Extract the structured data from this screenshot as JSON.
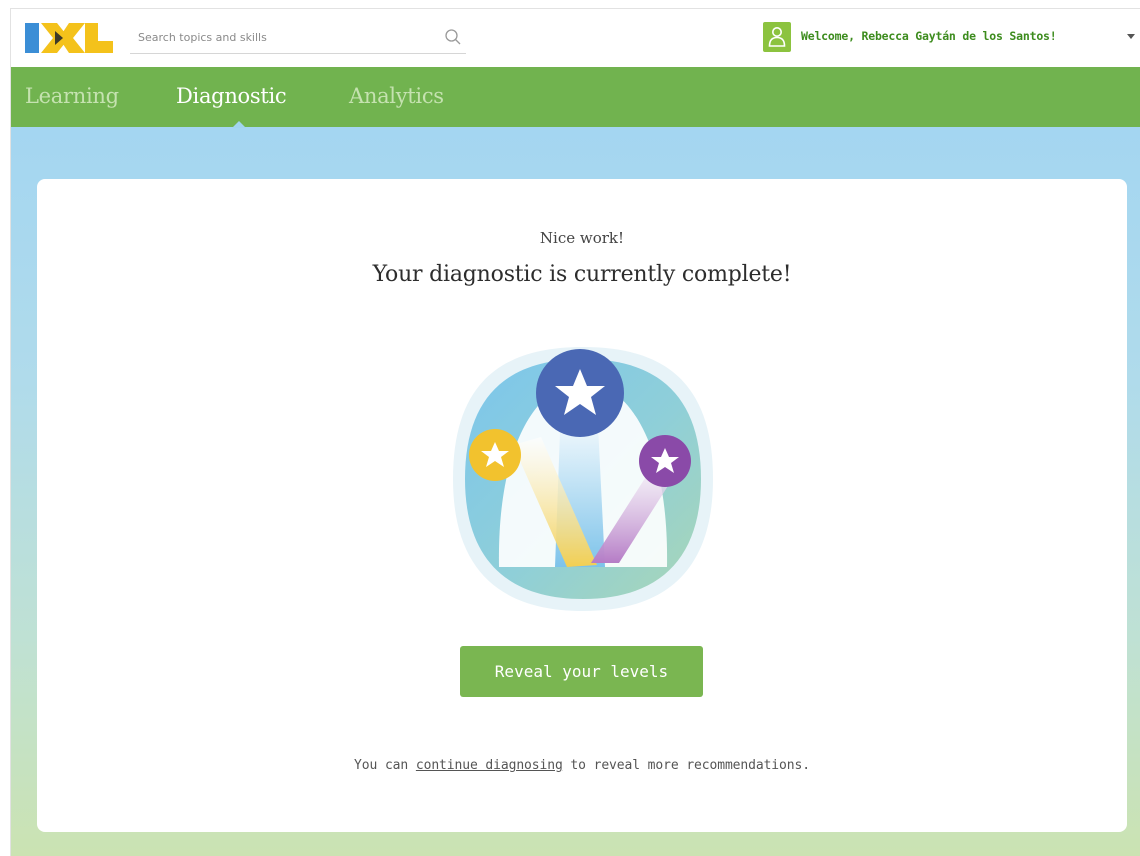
{
  "header": {
    "logo_text": "IXL",
    "search": {
      "placeholder": "Search topics and skills",
      "value": ""
    },
    "search_icon": "search-icon",
    "user_icon": "user-icon",
    "welcome_text": "Welcome, Rebecca Gaytán de los Santos!",
    "dropdown_icon": "caret-down-icon"
  },
  "nav": {
    "tabs": [
      {
        "label": "Learning",
        "active": false
      },
      {
        "label": "Diagnostic",
        "active": true
      },
      {
        "label": "Analytics",
        "active": false
      }
    ]
  },
  "card": {
    "subtitle": "Nice work!",
    "title": "Your diagnostic is currently complete!",
    "badge_icon": "shooting-stars-icon",
    "reveal_button": "Reveal your levels",
    "footer": {
      "prefix": "You can ",
      "link": "continue diagnosing",
      "suffix": " to reveal more recommendations."
    }
  },
  "colors": {
    "brand_green": "#71b34f",
    "button_green": "#7ab651",
    "welcome_green": "#3d8c1e",
    "logo_blue": "#3b8ed6",
    "logo_yellow": "#f4c21b",
    "star_blue": "#4a68b4",
    "star_yellow": "#f2c22e",
    "star_purple": "#8a4aa8"
  }
}
